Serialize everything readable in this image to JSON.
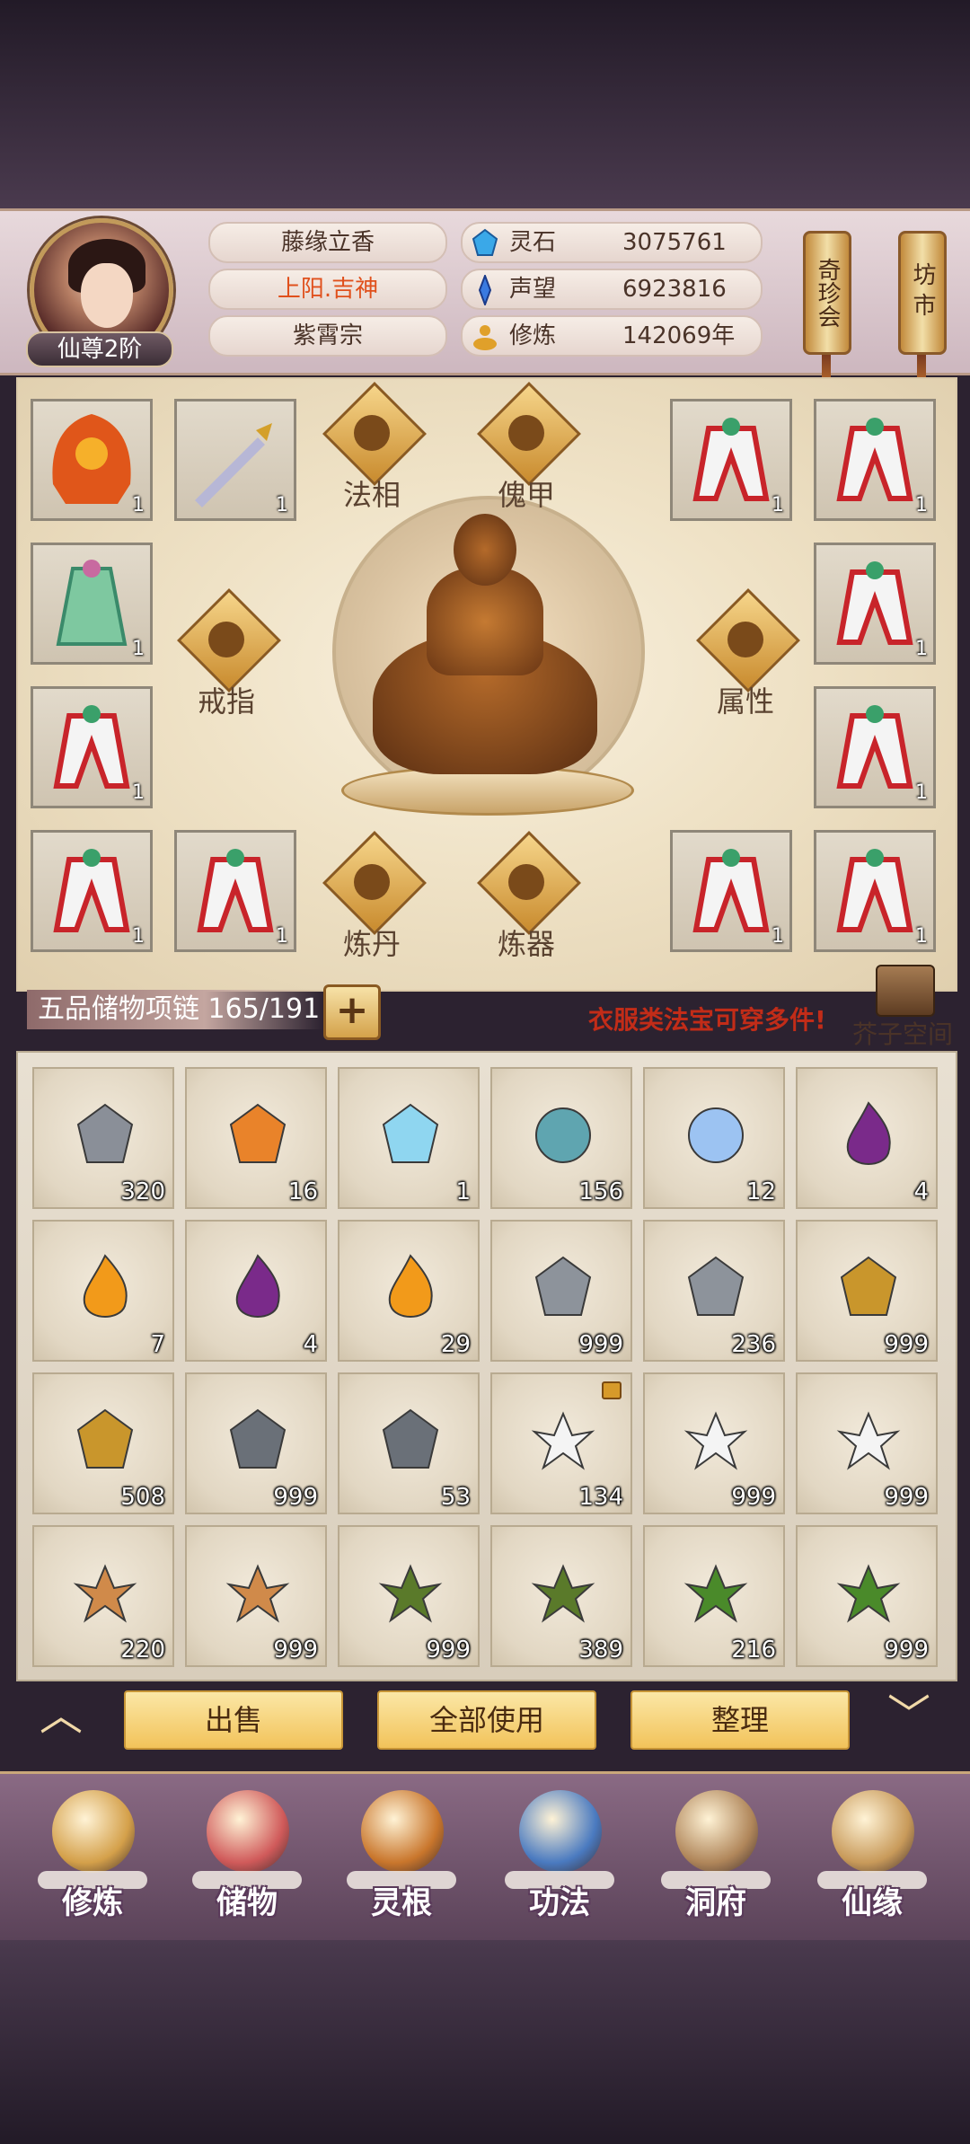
{
  "player": {
    "rank": "仙尊2阶",
    "name": "藤缘立香",
    "title": "上阳.吉神",
    "sect": "紫霄宗"
  },
  "resources": [
    {
      "label": "灵石",
      "value": "3075761",
      "icon": "spirit-stone-icon"
    },
    {
      "label": "声望",
      "value": "6923816",
      "icon": "reputation-icon"
    },
    {
      "label": "修炼",
      "value": "142069年",
      "icon": "cultivation-icon"
    }
  ],
  "shortcuts": [
    {
      "label": "奇珍会"
    },
    {
      "label": "坊市"
    }
  ],
  "equipment": {
    "function_buttons": [
      {
        "label": "法相"
      },
      {
        "label": "傀甲"
      },
      {
        "label": "戒指"
      },
      {
        "label": "属性"
      },
      {
        "label": "炼丹"
      },
      {
        "label": "炼器"
      }
    ],
    "slots": [
      {
        "item": "fire-robe",
        "count": "1"
      },
      {
        "item": "dagger",
        "count": "1"
      },
      {
        "item": "white-red-robe",
        "count": "1"
      },
      {
        "item": "white-red-robe",
        "count": "1"
      },
      {
        "item": "green-robe",
        "count": "1"
      },
      {
        "item": "white-red-robe",
        "count": "1"
      },
      {
        "item": "white-red-robe",
        "count": "1"
      },
      {
        "item": "white-red-robe",
        "count": "1"
      },
      {
        "item": "white-red-robe",
        "count": "1"
      },
      {
        "item": "white-red-robe",
        "count": "1"
      },
      {
        "item": "white-red-robe",
        "count": "1"
      },
      {
        "item": "white-red-robe",
        "count": "1"
      }
    ]
  },
  "bag": {
    "label": "五品储物项链 165/191",
    "add_label": "+",
    "tip": "衣服类法宝可穿多件!",
    "space_label": "芥子空间"
  },
  "inventory": [
    {
      "item": "gray-stone-shards",
      "count": "320",
      "color": "#8a8f98"
    },
    {
      "item": "orange-crystal",
      "count": "16",
      "color": "#e9832a"
    },
    {
      "item": "blue-crystal",
      "count": "1",
      "color": "#8fd6f0"
    },
    {
      "item": "teal-orb",
      "count": "156",
      "color": "#5fa5b0"
    },
    {
      "item": "blue-orb",
      "count": "12",
      "color": "#9cc3f2"
    },
    {
      "item": "purple-flame",
      "count": "4",
      "color": "#7a2a8a"
    },
    {
      "item": "orange-flame",
      "count": "7",
      "color": "#f29a1a"
    },
    {
      "item": "purple-flame",
      "count": "4",
      "color": "#7a2a8a"
    },
    {
      "item": "orange-flame",
      "count": "29",
      "color": "#f29a1a"
    },
    {
      "item": "silver-ore",
      "count": "999",
      "color": "#8d939b"
    },
    {
      "item": "silver-ore",
      "count": "236",
      "color": "#8d939b"
    },
    {
      "item": "gold-ore",
      "count": "999",
      "color": "#c9962c"
    },
    {
      "item": "gold-ore",
      "count": "508",
      "color": "#c9962c"
    },
    {
      "item": "iron-ingot",
      "count": "999",
      "color": "#6a7078"
    },
    {
      "item": "iron-ingot",
      "count": "53",
      "color": "#6a7078"
    },
    {
      "item": "white-lily",
      "count": "134",
      "color": "#f4f4f4",
      "locked": true
    },
    {
      "item": "white-lily",
      "count": "999",
      "color": "#f4f4f4"
    },
    {
      "item": "white-lily",
      "count": "999",
      "color": "#f4f4f4"
    },
    {
      "item": "ginseng",
      "count": "220",
      "color": "#d08a4a"
    },
    {
      "item": "ginseng",
      "count": "999",
      "color": "#d08a4a"
    },
    {
      "item": "herb-root",
      "count": "999",
      "color": "#5a7a2a"
    },
    {
      "item": "herb-root",
      "count": "389",
      "color": "#5a7a2a"
    },
    {
      "item": "berry-herb",
      "count": "216",
      "color": "#4a8a2a"
    },
    {
      "item": "berry-herb",
      "count": "999",
      "color": "#4a8a2a"
    }
  ],
  "actions": [
    {
      "label": "出售"
    },
    {
      "label": "全部使用"
    },
    {
      "label": "整理"
    }
  ],
  "nav": [
    {
      "label": "修炼",
      "icon": "cultivate-icon",
      "color": "#d4a04a"
    },
    {
      "label": "储物",
      "icon": "storage-bag-icon",
      "color": "#d05a5a"
    },
    {
      "label": "灵根",
      "icon": "spirit-root-icon",
      "color": "#c9762c"
    },
    {
      "label": "功法",
      "icon": "technique-book-icon",
      "color": "#4a7ac0"
    },
    {
      "label": "洞府",
      "icon": "cave-dwelling-icon",
      "color": "#b0865a"
    },
    {
      "label": "仙缘",
      "icon": "immortal-fate-icon",
      "color": "#c89a5a"
    }
  ]
}
